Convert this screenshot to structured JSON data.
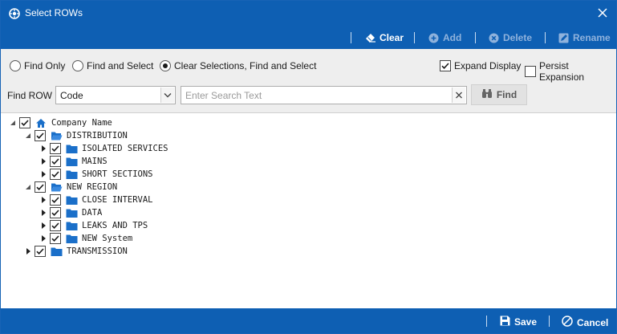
{
  "window": {
    "title": "Select ROWs"
  },
  "toolbar": {
    "clear": "Clear",
    "add": "Add",
    "delete": "Delete",
    "rename": "Rename"
  },
  "options": {
    "radios": [
      {
        "label": "Find Only",
        "selected": false
      },
      {
        "label": "Find and Select",
        "selected": false
      },
      {
        "label": "Clear Selections, Find and Select",
        "selected": true
      }
    ],
    "expand_display": {
      "label": "Expand Display",
      "checked": true
    },
    "persist_expansion": {
      "label": "Persist Expansion",
      "checked": false
    }
  },
  "find": {
    "label": "Find ROW",
    "field_value": "Code",
    "search_placeholder": "Enter Search Text",
    "search_value": "",
    "button": "Find"
  },
  "tree": {
    "root": {
      "label": "Company Name",
      "checked": true,
      "expanded": true
    },
    "nodes": [
      {
        "label": "DISTRIBUTION",
        "checked": true,
        "expanded": true,
        "children": [
          {
            "label": "ISOLATED SERVICES",
            "checked": true
          },
          {
            "label": "MAINS",
            "checked": true
          },
          {
            "label": "SHORT SECTIONS",
            "checked": true
          }
        ]
      },
      {
        "label": "NEW REGION",
        "checked": true,
        "expanded": true,
        "children": [
          {
            "label": "CLOSE INTERVAL",
            "checked": true
          },
          {
            "label": "DATA",
            "checked": true
          },
          {
            "label": "LEAKS AND TPS",
            "checked": true
          },
          {
            "label": "NEW System",
            "checked": true
          }
        ]
      },
      {
        "label": "TRANSMISSION",
        "checked": true,
        "expanded": false,
        "children": []
      }
    ]
  },
  "footer": {
    "save": "Save",
    "cancel": "Cancel"
  },
  "colors": {
    "accent": "#0e5fb3",
    "folder": "#1a6fc9",
    "background": "#eeeeee"
  }
}
